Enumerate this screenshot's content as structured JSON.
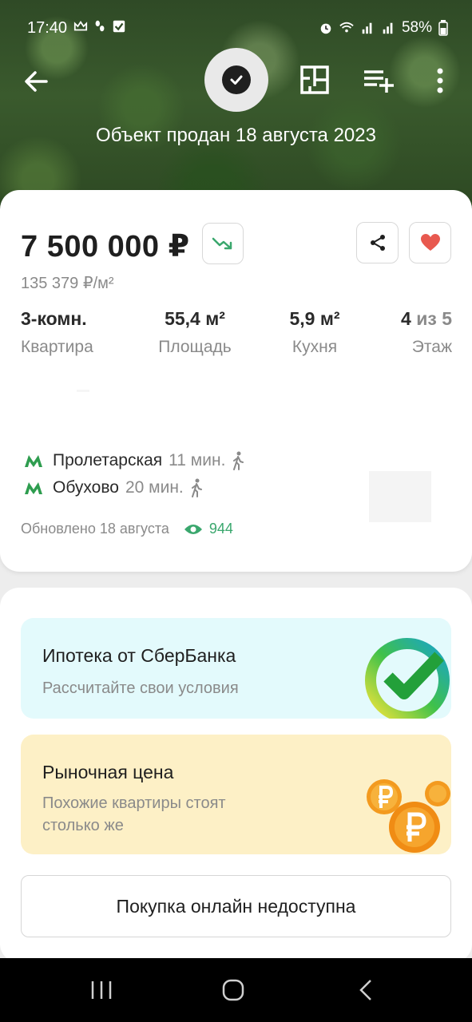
{
  "status_bar": {
    "time": "17:40",
    "battery": "58%",
    "left_icons": [
      "crown-icon",
      "footsteps-icon",
      "checkbox-icon"
    ],
    "right_icons": [
      "alarm-icon",
      "wifi-icon",
      "signal-icon",
      "signal-icon",
      "battery-icon"
    ]
  },
  "toolbar": {
    "icons": [
      "arrow-back-icon",
      "check-circle-icon",
      "floor-plan-icon",
      "playlist-add-icon",
      "more-vert-icon"
    ]
  },
  "sold_caption": "Объект продан 18 августа 2023",
  "listing": {
    "price": "7 500 000 ₽",
    "price_per_m2": "135 379 ₽/м²",
    "specs": [
      {
        "value": "3-комн.",
        "label": "Квартира"
      },
      {
        "value": "55,4 м²",
        "label": "Площадь"
      },
      {
        "value": "5,9 м²",
        "label": "Кухня"
      },
      {
        "value_main": "4",
        "value_muted": "из 5",
        "label": "Этаж"
      }
    ],
    "metro": [
      {
        "name": "Пролетарская",
        "time": "11 мин."
      },
      {
        "name": "Обухово",
        "time": "20 мин."
      }
    ],
    "updated": "Обновлено 18 августа",
    "views": "944"
  },
  "promos": {
    "sber": {
      "title": "Ипотека от СберБанка",
      "subtitle": "Рассчитайте свои условия"
    },
    "market": {
      "title": "Рыночная цена",
      "subtitle": "Похожие квартиры стоят столько же"
    }
  },
  "buy_button": "Покупка онлайн недоступна",
  "colors": {
    "accent_green": "#3aa76d",
    "heart_red": "#e8594f",
    "sber_bg": "#e3fafc",
    "market_bg": "#fdf0c6"
  }
}
